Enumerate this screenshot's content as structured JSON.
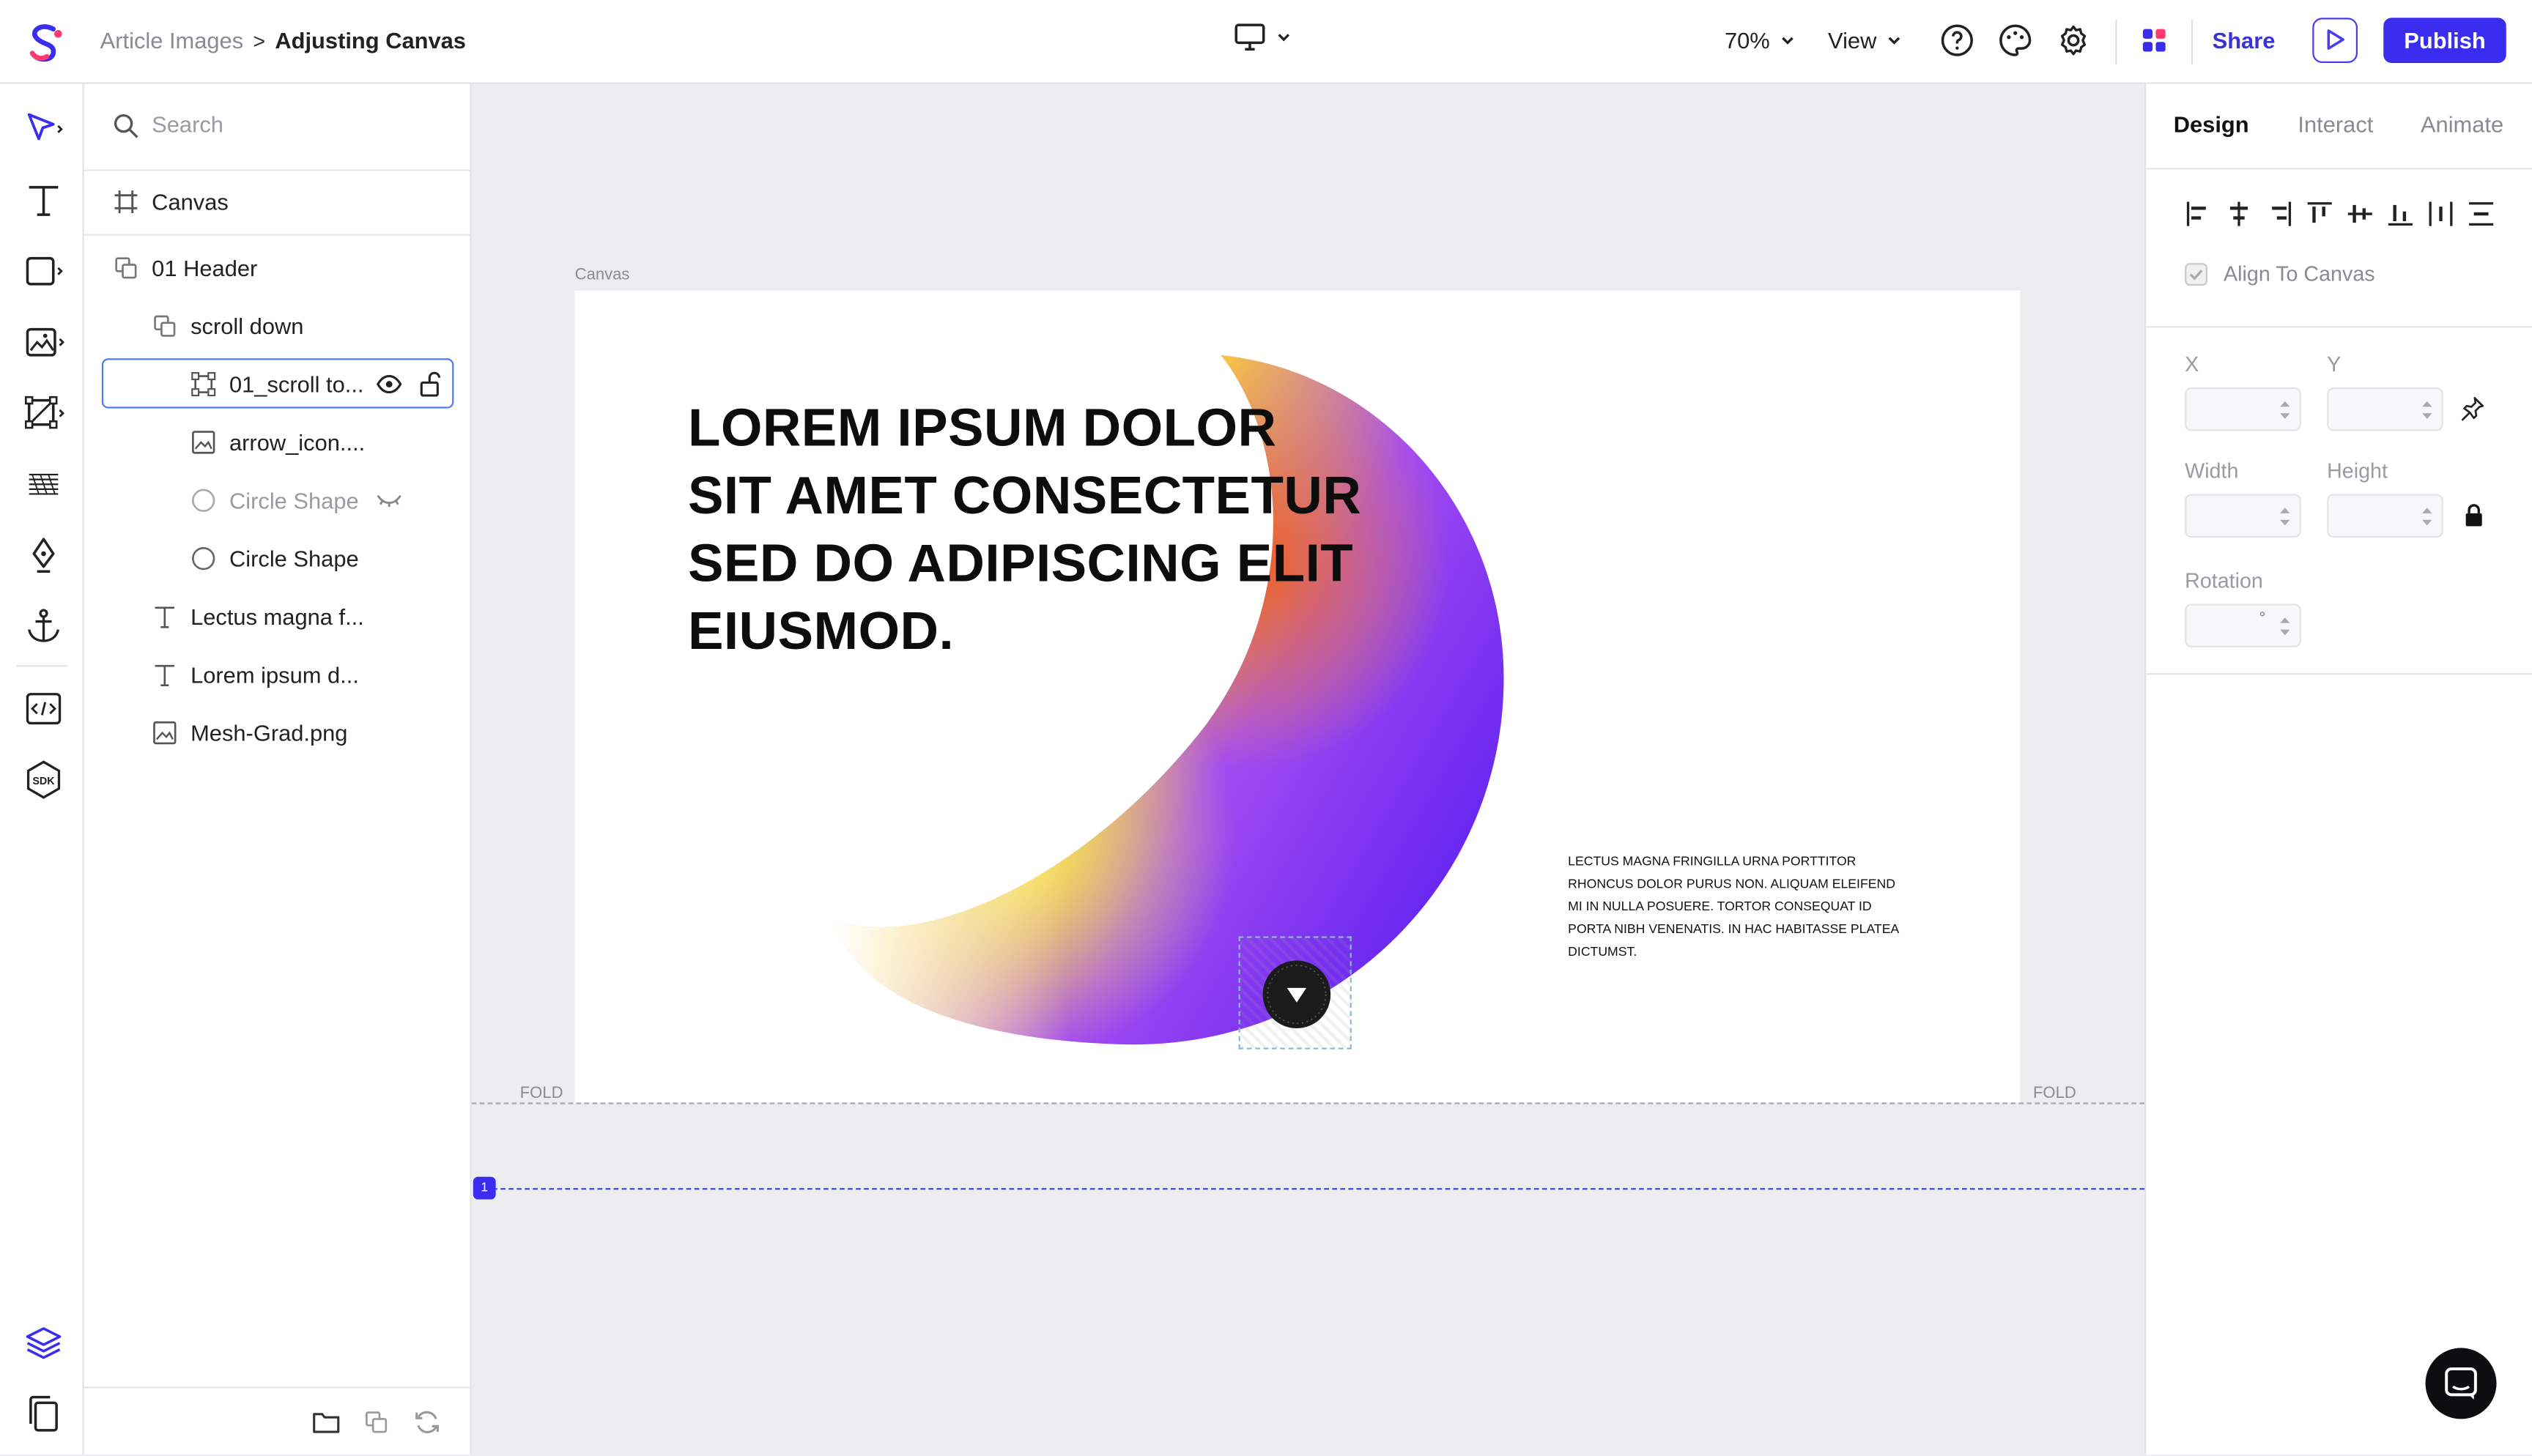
{
  "header": {
    "breadcrumb_parent": "Article Images",
    "breadcrumb_separator": ">",
    "breadcrumb_current": "Adjusting Canvas",
    "zoom": "70%",
    "view_label": "View",
    "share_label": "Share",
    "publish_label": "Publish"
  },
  "layers": {
    "search_placeholder": "Search",
    "canvas_label": "Canvas",
    "items": [
      {
        "label": "01 Header"
      },
      {
        "label": "scroll down"
      },
      {
        "label": "01_scroll to..."
      },
      {
        "label": "arrow_icon...."
      },
      {
        "label": "Circle Shape"
      },
      {
        "label": "Circle Shape"
      },
      {
        "label": "Lectus magna f..."
      },
      {
        "label": "Lorem ipsum d..."
      },
      {
        "label": "Mesh-Grad.png"
      }
    ]
  },
  "canvas": {
    "frame_label": "Canvas",
    "headline": "LOREM IPSUM DOLOR SIT AMET CONSECTETUR SED DO ADIPISCING ELIT EIUSMOD.",
    "body": "LECTUS MAGNA FRINGILLA URNA PORTTITOR RHONCUS DOLOR PURUS NON. ALIQUAM ELEIFEND MI IN NULLA POSUERE. TORTOR CONSEQUAT ID PORTA NIBH VENENATIS. IN HAC HABITASSE PLATEA DICTUMST.",
    "fold_label": "FOLD",
    "guide_number": "1"
  },
  "inspector": {
    "tabs": [
      "Design",
      "Interact",
      "Animate"
    ],
    "align_to_canvas": "Align To Canvas",
    "x_label": "X",
    "y_label": "Y",
    "width_label": "Width",
    "height_label": "Height",
    "rotation_label": "Rotation",
    "rotation_unit": "°"
  },
  "colors": {
    "accent": "#3a2df0",
    "share_text": "#3a33d4",
    "selection": "#4d7cf5",
    "guide": "#3b3be6"
  },
  "icons": {
    "toolbar": [
      "select-arrow-icon",
      "text-icon",
      "rectangle-icon",
      "image-icon",
      "frame-icon",
      "pattern-icon",
      "pen-icon",
      "anchor-icon",
      "code-icon",
      "sdk-icon",
      "layers-icon",
      "pages-icon"
    ]
  }
}
